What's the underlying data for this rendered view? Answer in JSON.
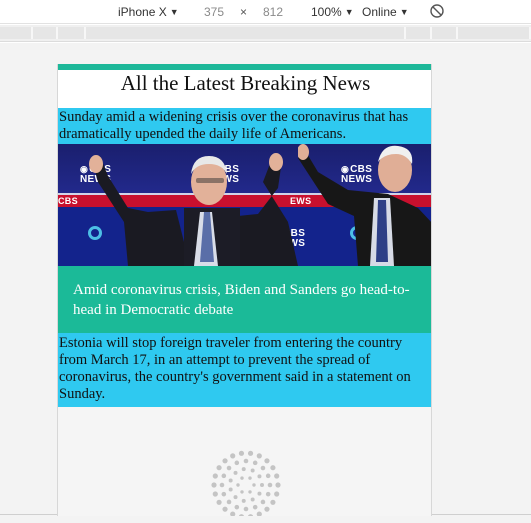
{
  "devtools": {
    "device": "iPhone X",
    "width": "375",
    "times": "×",
    "height": "812",
    "zoom": "100%",
    "network": "Online"
  },
  "page": {
    "title": "All the Latest Breaking News",
    "story1_text": "Sunday amid a widening crisis over the coronavirus that has dramatically upended the daily life of Americans.",
    "image_caption": "Amid coronavirus crisis, Biden and Sanders go head-to-head in Democratic debate",
    "story2_text": "Estonia will stop foreign traveler from entering the country from March 17, in an attempt to prevent the spread of coronavirus, the country's government said in a statement on Sunday.",
    "image_logo_text": "CBS NEWS"
  },
  "colors": {
    "accent_green": "#1db899",
    "story_cyan": "#2fc9f0",
    "caption_green": "#1bba98"
  }
}
